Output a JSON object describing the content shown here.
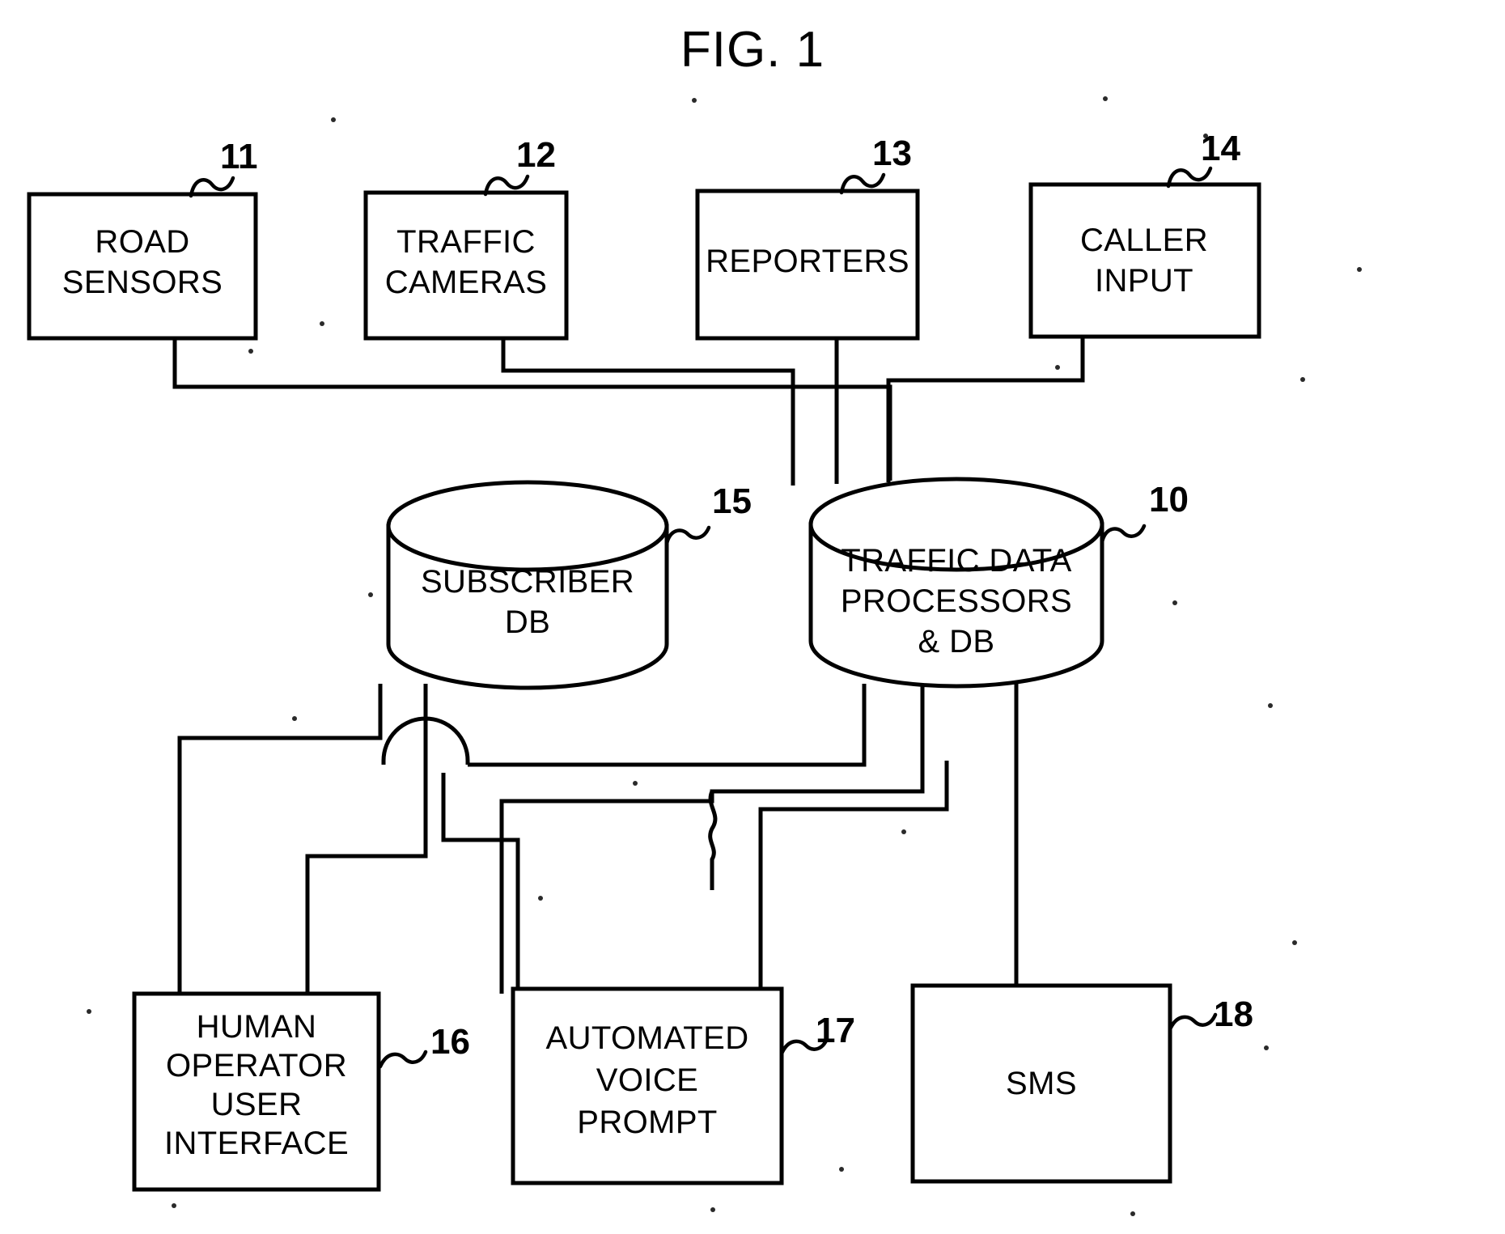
{
  "figure": {
    "title": "FIG. 1",
    "type": "patent-block-diagram",
    "ink_color": "#000000",
    "background_color": "#ffffff"
  },
  "nodes": {
    "road_sensors": {
      "label_line1": "ROAD",
      "label_line2": "SENSORS",
      "ref": "11",
      "shape": "rectangle"
    },
    "traffic_cameras": {
      "label_line1": "TRAFFIC",
      "label_line2": "CAMERAS",
      "ref": "12",
      "shape": "rectangle"
    },
    "reporters": {
      "label_line1": "REPORTERS",
      "ref": "13",
      "shape": "rectangle"
    },
    "caller_input": {
      "label_line1": "CALLER",
      "label_line2": "INPUT",
      "ref": "14",
      "shape": "rectangle"
    },
    "subscriber_db": {
      "label_line1": "SUBSCRIBER",
      "label_line2": "DB",
      "ref": "15",
      "shape": "cylinder"
    },
    "traffic_data_processors": {
      "label_line1": "TRAFFIC DATA",
      "label_line2": "PROCESSORS",
      "label_line3": "& DB",
      "ref": "10",
      "shape": "cylinder"
    },
    "human_operator_ui": {
      "label_line1": "HUMAN",
      "label_line2": "OPERATOR",
      "label_line3": "USER",
      "label_line4": "INTERFACE",
      "ref": "16",
      "shape": "rectangle"
    },
    "automated_voice_prompt": {
      "label_line1": "AUTOMATED",
      "label_line2": "VOICE",
      "label_line3": "PROMPT",
      "ref": "17",
      "shape": "rectangle"
    },
    "sms": {
      "label_line1": "SMS",
      "ref": "18",
      "shape": "rectangle"
    }
  },
  "connections": [
    {
      "from": "road_sensors",
      "to": "traffic_data_processors"
    },
    {
      "from": "traffic_cameras",
      "to": "traffic_data_processors"
    },
    {
      "from": "reporters",
      "to": "traffic_data_processors"
    },
    {
      "from": "caller_input",
      "to": "traffic_data_processors"
    },
    {
      "from": "subscriber_db",
      "to": "human_operator_ui"
    },
    {
      "from": "subscriber_db",
      "to": "automated_voice_prompt"
    },
    {
      "from": "traffic_data_processors",
      "to": "human_operator_ui"
    },
    {
      "from": "traffic_data_processors",
      "to": "automated_voice_prompt"
    },
    {
      "from": "traffic_data_processors",
      "to": "sms"
    }
  ]
}
